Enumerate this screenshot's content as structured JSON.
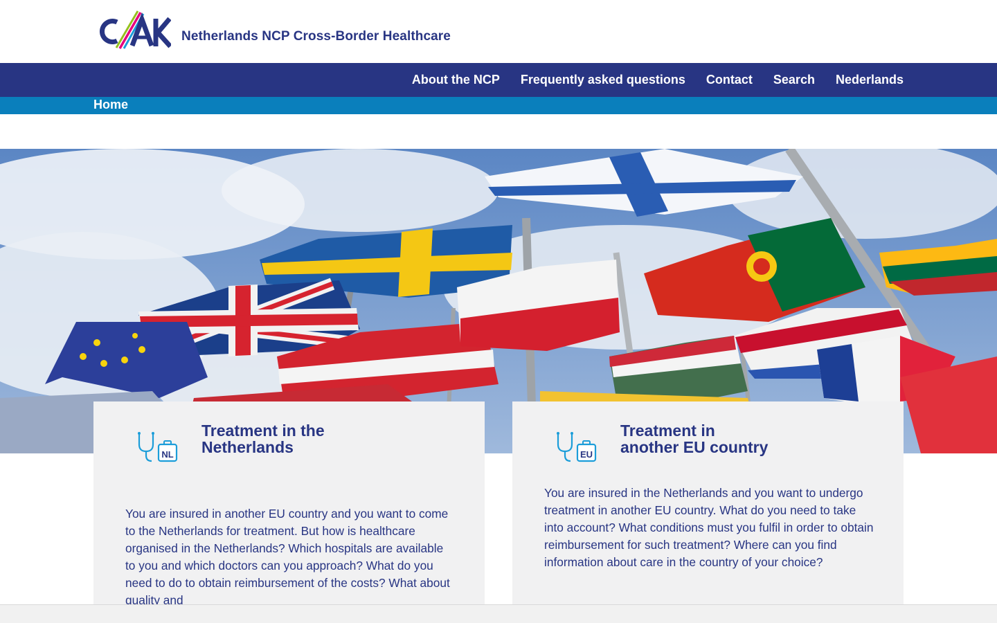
{
  "header": {
    "logo_text": "CAK",
    "site_title": "Netherlands NCP Cross-Border Healthcare"
  },
  "nav": {
    "items": [
      {
        "label": "About the NCP"
      },
      {
        "label": "Frequently asked questions"
      },
      {
        "label": "Contact"
      },
      {
        "label": "Search"
      },
      {
        "label": "Nederlands"
      }
    ]
  },
  "breadcrumb": {
    "home": "Home"
  },
  "cards": [
    {
      "title_line1": "Treatment in the",
      "title_line2": "Netherlands",
      "icon": "stethoscope-nl-icon",
      "icon_label": "NL",
      "text": "You are insured in another EU country and you want to come to the Netherlands for treatment. But how is healthcare organised in the Netherlands? Which hospitals are available to you and which doctors can you approach? What do you need to do to obtain reimbursement of the costs? What about quality and"
    },
    {
      "title_line1": "Treatment in",
      "title_line2": "another EU country",
      "icon": "stethoscope-eu-icon",
      "icon_label": "EU",
      "text": "You are insured in the Netherlands and you want to undergo treatment in another EU country. What do you need to take into account? What conditions must you fulfil in order to obtain reimbursement for such treatment? Where can you find information about care in the country of your choice?"
    }
  ],
  "colors": {
    "brand_navy": "#283583",
    "brand_blue": "#0a7fbc",
    "card_bg": "#f1f1f2",
    "icon_teal": "#1b9dd9",
    "logo_magenta": "#e6007e",
    "logo_green": "#95c11f"
  }
}
